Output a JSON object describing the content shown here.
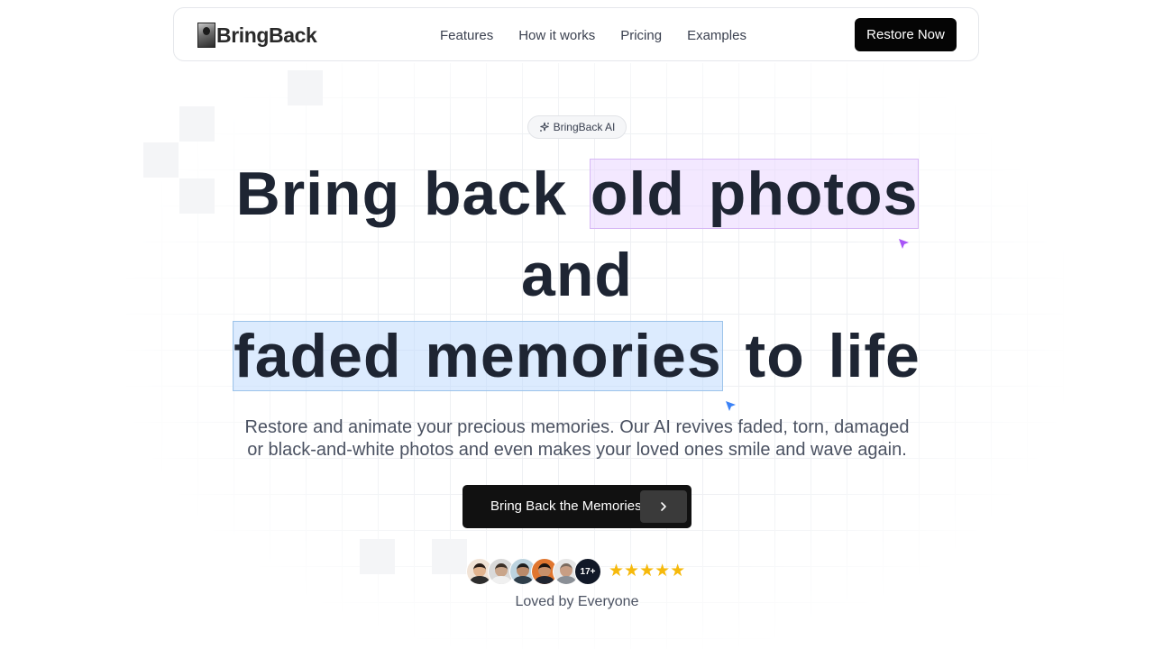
{
  "brand": {
    "name": "BringBack"
  },
  "nav": {
    "links": [
      "Features",
      "How it works",
      "Pricing",
      "Examples"
    ],
    "cta": "Restore Now"
  },
  "badge": {
    "label": "BringBack AI",
    "icon": "sparkles-icon"
  },
  "headline": {
    "part1": "Bring back ",
    "highlight1": "old photos",
    "part2": "and",
    "highlight2": "faded memories",
    "part3": " to life",
    "highlight1_color": "#e9d5ff",
    "highlight2_color": "#bfdbfe"
  },
  "subtitle": {
    "line1": "Restore and animate your precious memories. Our AI revives faded, torn, damaged",
    "line2": "or black-and-white photos and even makes your loved ones smile and wave again."
  },
  "cta": {
    "label": "Bring Back the Memories",
    "icon": "chevron-right-icon"
  },
  "social_proof": {
    "avatar_count": "17+",
    "stars": "★★★★★",
    "rating": 5,
    "caption": "Loved by Everyone"
  },
  "colors": {
    "accent": "#050505",
    "star": "#f6b90b",
    "cursor_purple": "#a855f7",
    "cursor_blue": "#3b82f6"
  }
}
